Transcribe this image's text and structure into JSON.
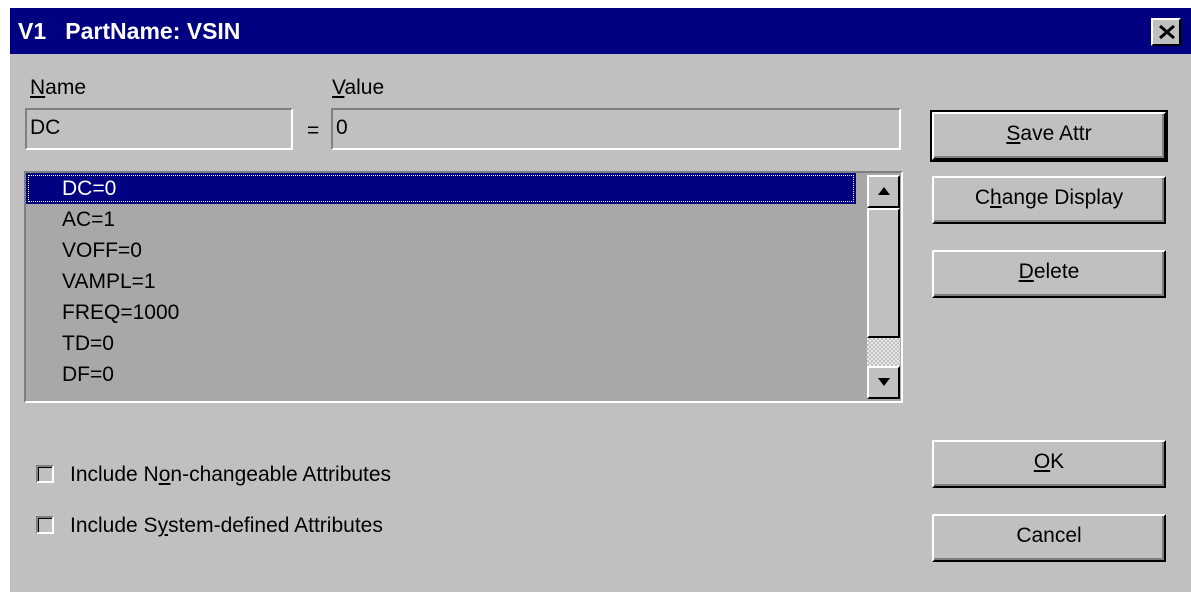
{
  "dialog": {
    "title": "V1   PartName: VSIN"
  },
  "labels": {
    "name_pre": "",
    "name_key": "N",
    "name_post": "ame",
    "value_pre": "",
    "value_key": "V",
    "value_post": "alue",
    "equals": "="
  },
  "fields": {
    "name_value": "DC",
    "value_value": "0"
  },
  "attributes": [
    "DC=0",
    "AC=1",
    "VOFF=0",
    "VAMPL=1",
    "FREQ=1000",
    "TD=0",
    "DF=0"
  ],
  "selected_index": 0,
  "buttons": {
    "save_pre": "",
    "save_key": "S",
    "save_post": "ave Attr",
    "change_pre": "C",
    "change_key": "h",
    "change_post": "ange Display",
    "delete_pre": "",
    "delete_key": "D",
    "delete_post": "elete",
    "ok_pre": "",
    "ok_key": "O",
    "ok_post": "K",
    "cancel": "Cancel"
  },
  "checkboxes": {
    "nonchangeable_pre": "Include N",
    "nonchangeable_key": "o",
    "nonchangeable_post": "n-changeable Attributes",
    "nonchangeable_checked": false,
    "system_pre": "Include S",
    "system_key": "y",
    "system_post": "stem-defined Attributes",
    "system_checked": false
  },
  "icons": {
    "close": "close-icon",
    "scroll_up": "up-arrow-icon",
    "scroll_down": "down-arrow-icon"
  }
}
